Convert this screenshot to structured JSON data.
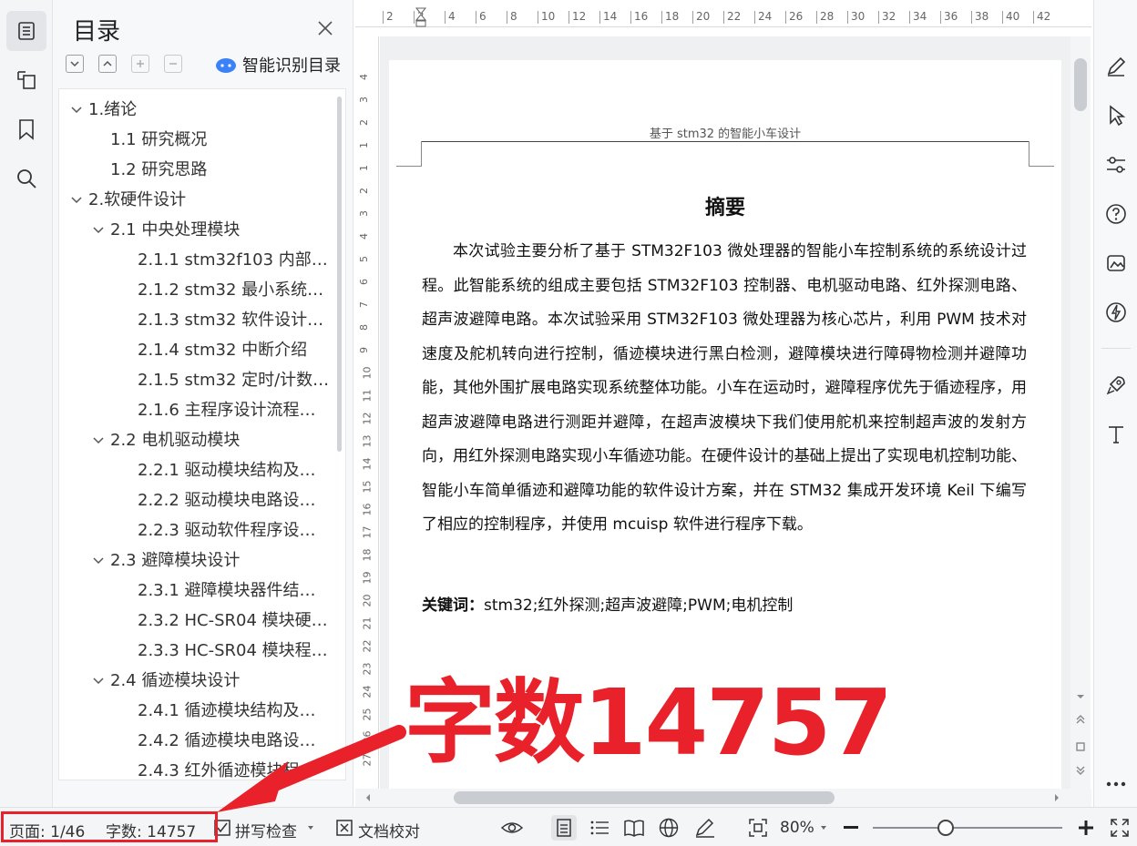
{
  "toc": {
    "title": "目录",
    "smart_label": "智能识别目录",
    "items": [
      {
        "label": "1.绪论",
        "level": 1,
        "expanded": true
      },
      {
        "label": "1.1 研究概况",
        "level": 2
      },
      {
        "label": "1.2 研究思路",
        "level": 2
      },
      {
        "label": "2.软硬件设计",
        "level": 1,
        "expanded": true
      },
      {
        "label": "2.1 中央处理模块",
        "level": 2,
        "expanded": true
      },
      {
        "label": "2.1.1 stm32f103 内部…",
        "level": 3
      },
      {
        "label": "2.1.2 stm32 最小系统…",
        "level": 3
      },
      {
        "label": "2.1.3 stm32 软件设计…",
        "level": 3
      },
      {
        "label": "2.1.4 stm32 中断介绍",
        "level": 3
      },
      {
        "label": "2.1.5 stm32 定时/计数…",
        "level": 3
      },
      {
        "label": "2.1.6  主程序设计流程…",
        "level": 3
      },
      {
        "label": "2.2  电机驱动模块",
        "level": 2,
        "expanded": true
      },
      {
        "label": "2.2.1  驱动模块结构及…",
        "level": 3
      },
      {
        "label": "2.2.2  驱动模块电路设…",
        "level": 3
      },
      {
        "label": "2.2.3 驱动软件程序设…",
        "level": 3
      },
      {
        "label": "2.3  避障模块设计",
        "level": 2,
        "expanded": true
      },
      {
        "label": "2.3.1  避障模块器件结…",
        "level": 3
      },
      {
        "label": "2.3.2 HC-SR04 模块硬…",
        "level": 3
      },
      {
        "label": "2.3.3 HC-SR04 模块程…",
        "level": 3
      },
      {
        "label": "2.4 循迹模块设计",
        "level": 2,
        "expanded": true
      },
      {
        "label": "2.4.1  循迹模块结构及…",
        "level": 3
      },
      {
        "label": "2.4.2  循迹模块电路设…",
        "level": 3
      },
      {
        "label": "2.4.3  红外循迹模块程…",
        "level": 3
      }
    ]
  },
  "ruler": {
    "top_numbers": [
      "2",
      "2",
      "4",
      "6",
      "8",
      "10",
      "12",
      "14",
      "16",
      "18",
      "20",
      "22",
      "24",
      "26",
      "28",
      "30",
      "32",
      "34",
      "36",
      "38",
      "40",
      "42"
    ],
    "side_numbers": [
      "4",
      "3",
      "2",
      "1",
      "1",
      "2",
      "3",
      "4",
      "5",
      "6",
      "7",
      "8",
      "9",
      "10",
      "11",
      "12",
      "13",
      "14",
      "15",
      "16",
      "17",
      "18",
      "19",
      "20",
      "21",
      "22",
      "23",
      "24",
      "25",
      "26",
      "27"
    ]
  },
  "document": {
    "header_text": "基于 stm32 的智能小车设计",
    "abstract_title": "摘要",
    "abstract_body": "本次试验主要分析了基于 STM32F103 微处理器的智能小车控制系统的系统设计过程。此智能系统的组成主要包括 STM32F103 控制器、电机驱动电路、红外探测电路、超声波避障电路。本次试验采用 STM32F103 微处理器为核心芯片，利用 PWM 技术对速度及舵机转向进行控制，循迹模块进行黑白检测，避障模块进行障碍物检测并避障功能，其他外围扩展电路实现系统整体功能。小车在运动时，避障程序优先于循迹程序，用超声波避障电路进行测距并避障，在超声波模块下我们使用舵机来控制超声波的发射方向，用红外探测电路实现小车循迹功能。在硬件设计的基础上提出了实现电机控制功能、智能小车简单循迹和避障功能的软件设计方案，并在 STM32 集成开发环境 Keil 下编写了相应的控制程序，并使用 mcuisp 软件进行程序下载。",
    "keywords_label": "关键词：",
    "keywords_value": "stm32;红外探测;超声波避障;PWM;电机控制"
  },
  "status": {
    "page": "页面: 1/46",
    "word_count": "字数: 14757",
    "spell_check": "拼写检查",
    "proofread": "文档校对",
    "zoom": "80%",
    "zoom_level_percent": 80
  },
  "annotation": {
    "big_text": "字数14757",
    "color": "#e8212a"
  },
  "colors": {
    "accent_blue": "#3b82f6",
    "annotation_red": "#e8212a"
  }
}
